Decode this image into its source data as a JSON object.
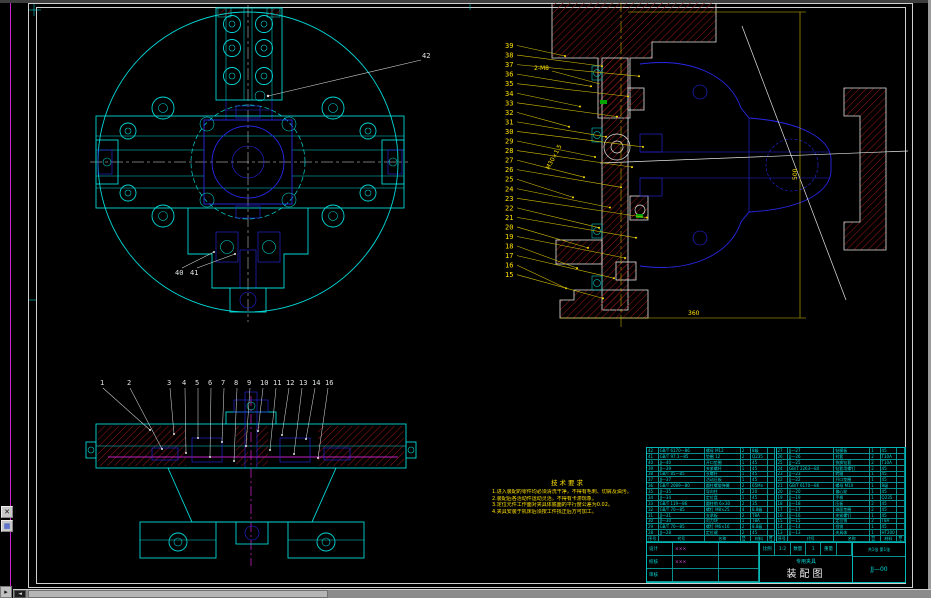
{
  "colors": {
    "canvas_bg": "#000000",
    "line_cyan": "#00d8d8",
    "line_blue": "#2727e8",
    "line_yellow": "#ffe100",
    "line_magenta": "#ff2bff",
    "hatch_red": "#8f1616",
    "line_white": "#e2e6e6"
  },
  "views": {
    "plan": {
      "callouts": {
        "c40": "40",
        "c41": "41",
        "c42": "42"
      }
    },
    "side": {
      "callouts": [
        "39",
        "38",
        "37",
        "36",
        "35",
        "34",
        "33",
        "32",
        "31",
        "30",
        "29",
        "28",
        "27",
        "26",
        "25",
        "24",
        "23",
        "22",
        "21",
        "20",
        "19",
        "18",
        "17",
        "16",
        "15"
      ],
      "label_top": "2-M8",
      "thread_note": "M30×1.5",
      "dim_vertical": "500",
      "dim_horizontal": "360"
    },
    "front": {
      "callouts": [
        "1",
        "2",
        "3",
        "4",
        "5",
        "6",
        "7",
        "8",
        "9",
        "10",
        "11",
        "12",
        "13",
        "14",
        "16"
      ]
    }
  },
  "notes": {
    "title": "技术要求",
    "lines": [
      "1.进入装配的零件均必须清洗干净，不得有毛刺、切屑及油污。",
      "2.装配后各活动件运动灵活，不得有卡滞现象。",
      "3.定位元件工作面对夹具体底面的平行度公差为0.02。",
      "4.夹具安装于机床后须按工件找正后方可加工。"
    ]
  },
  "bom": {
    "headers": [
      "序号",
      "代号",
      "名称",
      "数量",
      "材料",
      "备注"
    ],
    "left_rows": [
      {
        "no": "42",
        "code": "GB/T 6170—86",
        "name": "螺母 M12",
        "qty": "2",
        "mat": "8级",
        "rem": ""
      },
      {
        "no": "41",
        "code": "GB/T 97.1—85",
        "name": "垫圈 12",
        "qty": "2",
        "mat": "Q235",
        "rem": ""
      },
      {
        "no": "40",
        "code": "JJ—40",
        "name": "开口垫圈",
        "qty": "1",
        "mat": "45",
        "rem": ""
      },
      {
        "no": "39",
        "code": "JJ—39",
        "name": "夹紧螺杆",
        "qty": "1",
        "mat": "45",
        "rem": ""
      },
      {
        "no": "38",
        "code": "GB/T 85—85",
        "name": "长螺杆",
        "qty": "1",
        "mat": "45",
        "rem": ""
      },
      {
        "no": "37",
        "code": "JJ—37",
        "name": "活动压板",
        "qty": "1",
        "mat": "45",
        "rem": ""
      },
      {
        "no": "36",
        "code": "GB/T 2089—80",
        "name": "圆柱螺旋弹簧",
        "qty": "2",
        "mat": "65Mn",
        "rem": ""
      },
      {
        "no": "35",
        "code": "JJ—35",
        "name": "导向柱",
        "qty": "2",
        "mat": "20",
        "rem": ""
      },
      {
        "no": "34",
        "code": "JJ—34",
        "name": "定位盘",
        "qty": "1",
        "mat": "45",
        "rem": ""
      },
      {
        "no": "33",
        "code": "GB/T 119—86",
        "name": "圆柱销 6×30",
        "qty": "2",
        "mat": "35",
        "rem": ""
      },
      {
        "no": "32",
        "code": "GB/T 70—85",
        "name": "螺钉 M8×25",
        "qty": "4",
        "mat": "8.8级",
        "rem": ""
      },
      {
        "no": "31",
        "code": "JJ—31",
        "name": "支承板",
        "qty": "2",
        "mat": "T8A",
        "rem": ""
      },
      {
        "no": "30",
        "code": "JJ—30",
        "name": "对刀块",
        "qty": "1",
        "mat": "T8A",
        "rem": ""
      },
      {
        "no": "29",
        "code": "GB/T 70—85",
        "name": "螺钉 M6×16",
        "qty": "2",
        "mat": "8.8级",
        "rem": ""
      },
      {
        "no": "28",
        "code": "JJ—28",
        "name": "定位键",
        "qty": "2",
        "mat": "45",
        "rem": ""
      }
    ],
    "right_rows": [
      {
        "no": "27",
        "code": "JJ—27",
        "name": "钻模板",
        "qty": "1",
        "mat": "45",
        "rem": ""
      },
      {
        "no": "26",
        "code": "JJ—26",
        "name": "衬套",
        "qty": "2",
        "mat": "T10A",
        "rem": ""
      },
      {
        "no": "25",
        "code": "JJ—25",
        "name": "快换钻套",
        "qty": "2",
        "mat": "T10A",
        "rem": ""
      },
      {
        "no": "24",
        "code": "GB/T 2263—80",
        "name": "钻套用螺钉",
        "qty": "2",
        "mat": "45",
        "rem": ""
      },
      {
        "no": "23",
        "code": "JJ—23",
        "name": "转轴",
        "qty": "1",
        "mat": "45",
        "rem": ""
      },
      {
        "no": "22",
        "code": "JJ—22",
        "name": "开口垫圈",
        "qty": "1",
        "mat": "45",
        "rem": ""
      },
      {
        "no": "21",
        "code": "GB/T 6170—86",
        "name": "螺母 M10",
        "qty": "1",
        "mat": "8级",
        "rem": ""
      },
      {
        "no": "20",
        "code": "JJ—20",
        "name": "偏心轮",
        "qty": "1",
        "mat": "45",
        "rem": ""
      },
      {
        "no": "19",
        "code": "JJ—19",
        "name": "手柄",
        "qty": "1",
        "mat": "Q235",
        "rem": ""
      },
      {
        "no": "18",
        "code": "JJ—18",
        "name": "压板",
        "qty": "2",
        "mat": "45",
        "rem": ""
      },
      {
        "no": "17",
        "code": "JJ—17",
        "name": "球面垫圈",
        "qty": "2",
        "mat": "45",
        "rem": ""
      },
      {
        "no": "16",
        "code": "JJ—16",
        "name": "夹紧螺钉",
        "qty": "1",
        "mat": "45",
        "rem": ""
      },
      {
        "no": "15",
        "code": "JJ—15",
        "name": "定位销",
        "qty": "2",
        "mat": "T8A",
        "rem": ""
      },
      {
        "no": "14",
        "code": "JJ—14",
        "name": "挡销",
        "qty": "1",
        "mat": "45",
        "rem": ""
      },
      {
        "no": "13",
        "code": "JJ—13",
        "name": "夹具体",
        "qty": "1",
        "mat": "HT200",
        "rem": ""
      }
    ],
    "title_block": {
      "sign_rows": [
        {
          "label": "设计",
          "name": "×××",
          "date": ""
        },
        {
          "label": "校核",
          "name": "×××",
          "date": ""
        },
        {
          "label": "审核",
          "name": "",
          "date": ""
        }
      ],
      "scale_label": "比例",
      "scale": "1:2",
      "qty_label": "数量",
      "qty": "1",
      "weight_label": "重量",
      "weight": "",
      "title_small": "专用夹具",
      "title_main": "装配图",
      "sheet": "共1张 第1张",
      "drawing_no": "JJ—00"
    }
  },
  "chrome": {
    "scroll_left_glyph": "◄",
    "corner_glyph": "▸",
    "palette_close_glyph": "✕",
    "palette_pic_glyph": "▦"
  }
}
